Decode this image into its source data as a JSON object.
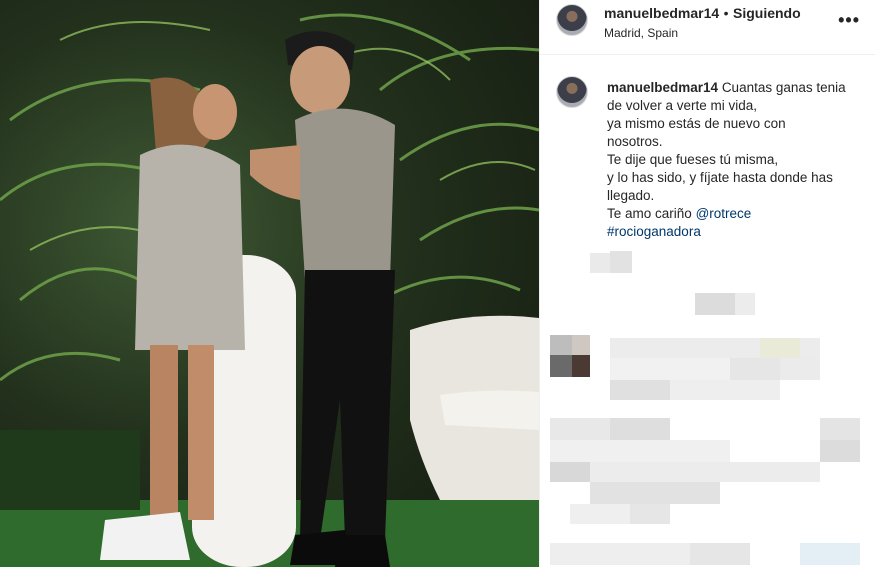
{
  "post": {
    "username": "manuelbedmar14",
    "separator": "•",
    "follow_status": "Siguiendo",
    "location": "Madrid, Spain",
    "more_icon": "more-horizontal-icon"
  },
  "caption": {
    "username": "manuelbedmar14",
    "lines": [
      "Cuantas ganas tenia",
      "de volver a verte mi vida,",
      "ya mismo estás de nuevo con",
      "nosotros.",
      "Te dije que fueses tú misma,",
      "y lo has sido, y fíjate hasta donde has",
      "llegado."
    ],
    "last_line_text": "Te amo cariño",
    "mention": "@rotrece",
    "hashtag": "#rocioganadora"
  },
  "colors": {
    "text": "#262626",
    "link": "#00376b",
    "border": "#efefef"
  }
}
